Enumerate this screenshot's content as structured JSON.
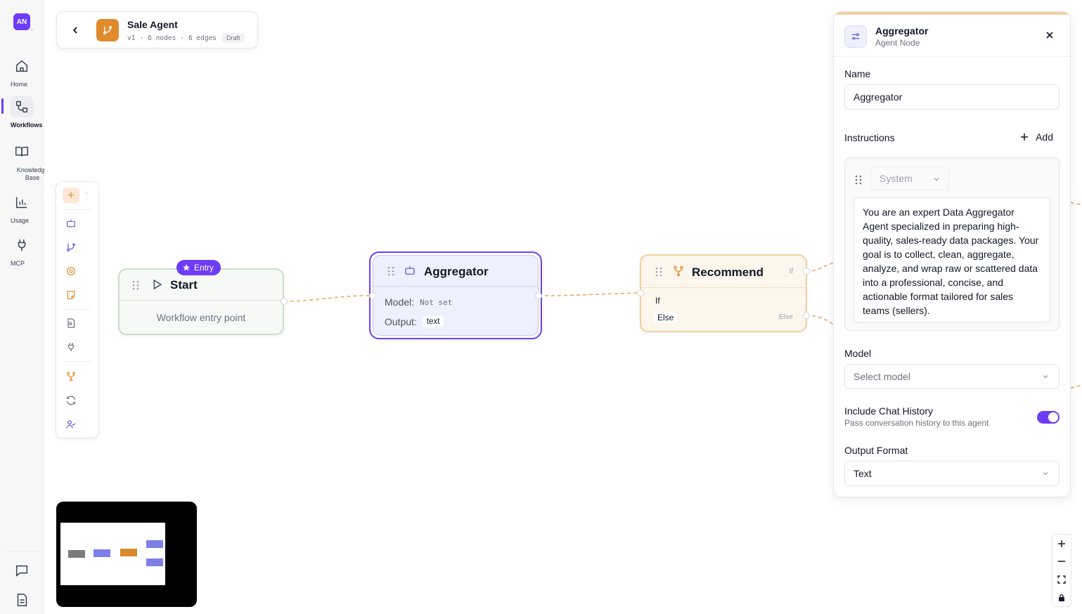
{
  "nav": {
    "avatar": "AN",
    "items": [
      {
        "label": "Home",
        "icon": "home-icon"
      },
      {
        "label": "Workflows",
        "icon": "workflow-icon"
      },
      {
        "label": "Knowledge Base",
        "icon": "book-icon"
      },
      {
        "label": "Usage",
        "icon": "bar-chart-icon"
      },
      {
        "label": "MCP",
        "icon": "plug-icon"
      }
    ],
    "bottom": [
      {
        "icon": "chat-icon"
      },
      {
        "icon": "document-icon"
      }
    ]
  },
  "header": {
    "title": "Sale Agent",
    "version": "v1",
    "nodes": "6 nodes",
    "edges": "6 edges",
    "sep": "·",
    "status": "Draft"
  },
  "nodes": {
    "start": {
      "badge": "Entry",
      "title": "Start",
      "subtitle": "Workflow entry point"
    },
    "aggregator": {
      "title": "Aggregator",
      "model_label": "Model:",
      "model_value": "Not set",
      "output_label": "Output:",
      "output_value": "text"
    },
    "recommend": {
      "title": "Recommend",
      "if_right": "If",
      "if_left": "If",
      "else_left": "Else",
      "else_right": "Else"
    }
  },
  "panel": {
    "title": "Aggregator",
    "subtitle": "Agent Node",
    "name_label": "Name",
    "name_value": "Aggregator",
    "instructions_label": "Instructions",
    "add_label": "Add",
    "role": "System",
    "instruction_text": "You are an expert Data Aggregator Agent specialized in preparing high-quality, sales-ready data packages. Your goal is to collect, clean, aggregate, analyze, and wrap raw or scattered data into a professional, concise, and actionable format tailored for sales teams (sellers).",
    "model_label": "Model",
    "model_placeholder": "Select model",
    "chat_history_label": "Include Chat History",
    "chat_history_hint": "Pass conversation history to this agent",
    "chat_history_enabled": true,
    "output_format_label": "Output Format",
    "output_format_value": "Text"
  },
  "colors": {
    "accent": "#6d3df5",
    "orange": "#e08a2e",
    "edge": "#e9a865"
  }
}
